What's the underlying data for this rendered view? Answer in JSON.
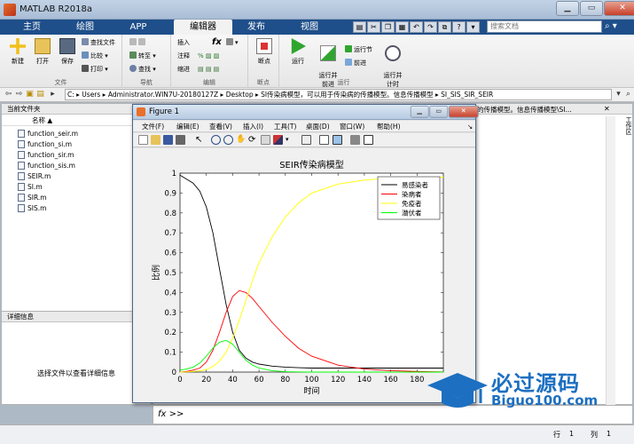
{
  "window": {
    "title": "MATLAB R2018a"
  },
  "tabs": [
    {
      "label": "主页",
      "active": false
    },
    {
      "label": "绘图",
      "active": false
    },
    {
      "label": "APP",
      "active": false
    },
    {
      "label": "编辑器",
      "active": true
    },
    {
      "label": "发布",
      "active": false
    },
    {
      "label": "视图",
      "active": false
    }
  ],
  "search": {
    "placeholder": "搜索文档"
  },
  "ribbon": {
    "file_group": {
      "label": "文件",
      "new": "新建",
      "open": "打开",
      "save": "保存",
      "find_files": "查找文件",
      "compare": "比较",
      "print": "打印"
    },
    "nav_group": {
      "label": "导航",
      "goto": "转至",
      "find": "查找"
    },
    "edit_group": {
      "label": "编辑",
      "insert": "插入",
      "comment": "注释",
      "indent": "缩进",
      "fx": "fx"
    },
    "breakpoint_group": {
      "label": "断点",
      "breakpoints": "断点"
    },
    "run_group": {
      "label": "运行",
      "run": "运行",
      "run_advance": "运行并\n前进",
      "run_section": "运行节",
      "advance": "前进",
      "run_time": "运行并\n计时"
    }
  },
  "address": {
    "path": "C:  ▸  Users  ▸  Administrator.WIN7U-20180127Z  ▸  Desktop  ▸  SI传染病模型，可以用于传染病的传播模型。信息传播模型  ▸  SI_SIS_SIR_SEIR"
  },
  "current_folder": {
    "title": "当前文件夹",
    "name_col": "名称 ▲",
    "files": [
      "function_seir.m",
      "function_si.m",
      "function_sir.m",
      "function_sis.m",
      "SEIR.m",
      "SI.m",
      "SIR.m",
      "SIS.m"
    ]
  },
  "details": {
    "title": "详细信息",
    "hint": "选择文件以查看详细信息"
  },
  "right_panel": {
    "title_fragment": "的传播模型。信息传播模型\\SI..."
  },
  "command": {
    "prompt": "fx >>"
  },
  "status": {
    "row_label": "行",
    "row": "1",
    "col_label": "列",
    "col": "1"
  },
  "figure": {
    "title": "Figure 1",
    "menus": [
      "文件(F)",
      "编辑(E)",
      "查看(V)",
      "插入(I)",
      "工具(T)",
      "桌面(D)",
      "窗口(W)",
      "帮助(H)"
    ]
  },
  "chart_data": {
    "type": "line",
    "title": "SEIR传染病模型",
    "xlabel": "时间",
    "ylabel": "比例",
    "xlim": [
      0,
      200
    ],
    "ylim": [
      0,
      1
    ],
    "xticks": [
      0,
      20,
      40,
      60,
      80,
      100,
      120,
      140,
      160,
      180
    ],
    "yticks": [
      0,
      0.1,
      0.2,
      0.3,
      0.4,
      0.5,
      0.6,
      0.7,
      0.8,
      0.9,
      1
    ],
    "legend_position": "top-right",
    "x": [
      0,
      5,
      10,
      15,
      20,
      25,
      30,
      35,
      40,
      45,
      50,
      55,
      60,
      70,
      80,
      90,
      100,
      120,
      140,
      160,
      180,
      200
    ],
    "series": [
      {
        "name": "易感染者",
        "color": "#000000",
        "values": [
          0.99,
          0.97,
          0.95,
          0.91,
          0.83,
          0.7,
          0.52,
          0.34,
          0.2,
          0.11,
          0.07,
          0.05,
          0.04,
          0.03,
          0.025,
          0.022,
          0.02,
          0.02,
          0.02,
          0.02,
          0.02,
          0.02
        ]
      },
      {
        "name": "染病者",
        "color": "#ff0000",
        "values": [
          0.0,
          0.003,
          0.01,
          0.02,
          0.05,
          0.11,
          0.2,
          0.3,
          0.38,
          0.41,
          0.4,
          0.37,
          0.33,
          0.25,
          0.18,
          0.12,
          0.08,
          0.035,
          0.015,
          0.007,
          0.003,
          0.001
        ]
      },
      {
        "name": "免疫者",
        "color": "#ffff00",
        "values": [
          0.0,
          0.001,
          0.003,
          0.006,
          0.013,
          0.028,
          0.055,
          0.1,
          0.17,
          0.26,
          0.36,
          0.46,
          0.55,
          0.68,
          0.78,
          0.85,
          0.9,
          0.945,
          0.965,
          0.975,
          0.978,
          0.98
        ]
      },
      {
        "name": "潜伏者",
        "color": "#00ff00",
        "values": [
          0.01,
          0.015,
          0.025,
          0.045,
          0.08,
          0.12,
          0.15,
          0.16,
          0.14,
          0.1,
          0.06,
          0.035,
          0.02,
          0.007,
          0.002,
          0.001,
          0,
          0,
          0,
          0,
          0,
          0
        ]
      }
    ]
  },
  "watermark": {
    "brand": "必过源码",
    "url": "Biguo100.com"
  }
}
